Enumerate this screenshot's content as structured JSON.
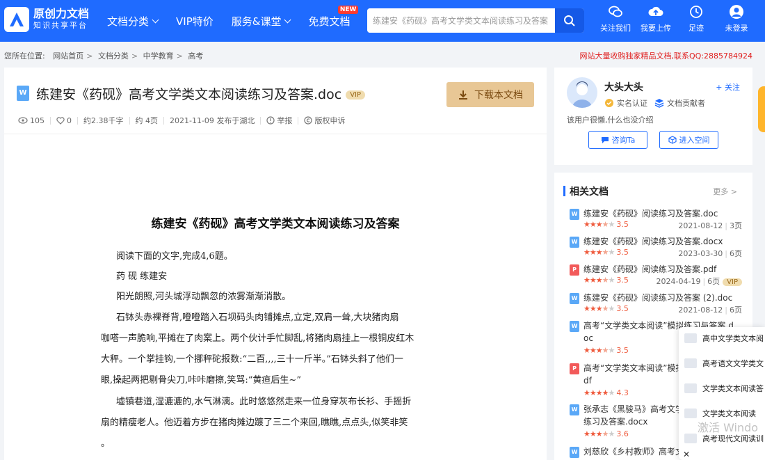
{
  "header": {
    "logo_line1": "原创力文档",
    "logo_line2": "知识共享平台",
    "nav": [
      {
        "label": "文档分类",
        "chevron": true
      },
      {
        "label": "VIP特价",
        "chevron": false
      },
      {
        "label": "服务&课堂",
        "chevron": true
      },
      {
        "label": "免费文档",
        "chevron": false,
        "badge": "NEW"
      }
    ],
    "search_value": "练建安《药砚》高考文学类文本阅读练习及答案",
    "icons": [
      {
        "label": "关注我们",
        "icon": "wechat-icon"
      },
      {
        "label": "我要上传",
        "icon": "upload-cloud-icon"
      },
      {
        "label": "足迹",
        "icon": "history-icon"
      },
      {
        "label": "未登录",
        "icon": "user-icon"
      }
    ]
  },
  "breadcrumb": {
    "prefix": "您所在位置:",
    "items": [
      "网站首页",
      "文档分类",
      "中学教育",
      "高考"
    ]
  },
  "notice": "网站大量收购独家精品文档,联系QQ:2885784924",
  "doc": {
    "type_icon": "W",
    "title": "练建安《药砚》高考文学类文本阅读练习及答案.doc",
    "vip": "VIP",
    "download_label": "下载本文档",
    "views": "105",
    "likes": "0",
    "words": "约2.38千字",
    "pages": "约 4页",
    "date": "2021-11-09 发布于湖北",
    "report": "举报",
    "copyright": "版权申诉"
  },
  "paper": {
    "heading": "练建安《药砚》高考文学类文本阅读练习及答案",
    "lines": [
      "阅读下面的文字,完成4,6题。",
      "药  砚  练建安",
      "阳光朗照,河头城浮动飘忽的浓雾渐渐消散。",
      "石钵头赤裸脊背,噔噔踏入石坝码头肉铺摊点,立定,双肩一耸,大块猪肉扇",
      "咖嗒一声脆响,平摊在了肉案上。两个伙计手忙脚乱,将猪肉扇挂上一根铜皮红木",
      "大秤。一个掌挂钩,一个挪秤砣报数:“二百,,,,三十一斤半。”石钵头斜了他们一",
      "眼,操起两把剔骨尖刀,咔咔磨擦,笑骂:“黄疸后生~”",
      "墟镇巷道,湿漉漉的,水气淋漓。此时悠悠然走来一位身穿灰布长衫、手摇折",
      "扇的精瘦老人。他迈着方步在猪肉摊边踱了三二个来回,瞧瞧,点点头,似笑非笑",
      "。"
    ]
  },
  "author": {
    "name": "大头大头",
    "follow": "+ 关注",
    "badge1": "实名认证",
    "badge2": "文档贡献者",
    "desc": "该用户很懒,什么也没介绍",
    "btn_ask": "咨询Ta",
    "btn_space": "进入空间"
  },
  "related": {
    "title": "相关文档",
    "more": "更多 >",
    "items": [
      {
        "icon": "W",
        "kind": "w",
        "title": "练建安《药砚》阅读练习及答案.doc",
        "stars": 3.5,
        "score": "3.5",
        "date": "2021-08-12",
        "pages": "3页"
      },
      {
        "icon": "W",
        "kind": "w",
        "title": "练建安《药砚》阅读练习及答案.docx",
        "stars": 3.5,
        "score": "3.5",
        "date": "2023-03-30",
        "pages": "6页"
      },
      {
        "icon": "P",
        "kind": "p",
        "title": "练建安《药砚》阅读练习及答案.pdf",
        "stars": 3.5,
        "score": "3.5",
        "date": "2024-04-19",
        "pages": "6页",
        "vip": "VIP"
      },
      {
        "icon": "W",
        "kind": "w",
        "title": "练建安《药砚》阅读练习及答案 (2).doc",
        "stars": 3.5,
        "score": "3.5",
        "date": "2021-08-12",
        "pages": "6页"
      },
      {
        "icon": "W",
        "kind": "w",
        "title": "高考“文学类文本阅读”模拟练习与答案.d",
        "title2": "oc",
        "stars": 3.5,
        "score": "3.5",
        "date": "2021-09-2",
        "pages": ""
      },
      {
        "icon": "P",
        "kind": "p",
        "title": "高考“文学类文本阅读”模拟练习与答案.p",
        "title2": "df",
        "stars": 4.3,
        "score": "4.3",
        "date": "2021-08-",
        "pages": ""
      },
      {
        "icon": "W",
        "kind": "w",
        "title": "张承志《黑骏马》高考文学类文本阅读",
        "title2": "练习及答案.docx",
        "stars": 3.6,
        "score": "3.6",
        "date": "2024-0",
        "pages": ""
      },
      {
        "icon": "W",
        "kind": "w",
        "title": "刘慈欣《乡村教师》高考文学类文本阅",
        "stars": 0,
        "score": "",
        "date": "",
        "pages": ""
      }
    ]
  },
  "float_panel": {
    "items": [
      "高中文学类文本阅",
      "高考语文文学类文",
      "文学类文本阅读答",
      "文学类文本阅读",
      "高考现代文阅读训"
    ]
  },
  "watermark": "激活 Windo"
}
